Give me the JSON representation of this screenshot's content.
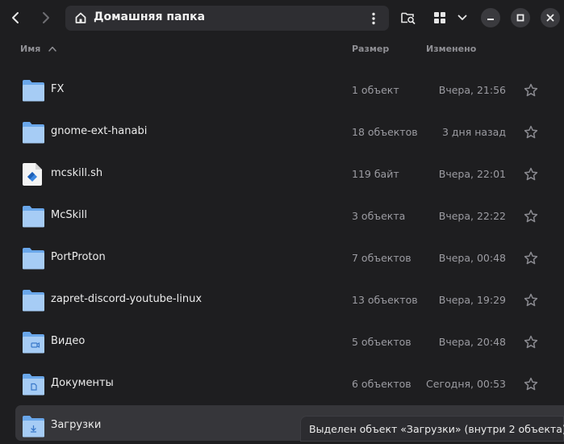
{
  "header": {
    "path_title": "Домашняя папка",
    "icons": [
      "chevron-left-icon",
      "chevron-right-icon",
      "home-icon",
      "kebab-menu-icon",
      "folder-search-icon",
      "grid-view-icon",
      "chevron-down-icon",
      "minimize-icon",
      "maximize-icon",
      "close-icon"
    ]
  },
  "columns": {
    "name": "Имя",
    "size": "Размер",
    "modified": "Изменено",
    "sort": "ascending"
  },
  "files": [
    {
      "name": "FX",
      "size": "1 объект",
      "modified": "Вчера, 21:56",
      "icon": "folder-icon"
    },
    {
      "name": "gnome-ext-hanabi",
      "size": "18 объектов",
      "modified": "3 дня назад",
      "icon": "folder-icon"
    },
    {
      "name": "mcskill.sh",
      "size": "119 байт",
      "modified": "Вчера, 22:01",
      "icon": "script-file-icon"
    },
    {
      "name": "McSkill",
      "size": "3 объекта",
      "modified": "Вчера, 22:22",
      "icon": "folder-icon"
    },
    {
      "name": "PortProton",
      "size": "7 объектов",
      "modified": "Вчера, 00:48",
      "icon": "folder-icon"
    },
    {
      "name": "zapret-discord-youtube-linux",
      "size": "13 объектов",
      "modified": "Вчера, 19:29",
      "icon": "folder-icon"
    },
    {
      "name": "Видео",
      "size": "5 объектов",
      "modified": "Вчера, 20:48",
      "icon": "videos-folder-icon"
    },
    {
      "name": "Документы",
      "size": "6 объектов",
      "modified": "Сегодня, 00:53",
      "icon": "documents-folder-icon"
    },
    {
      "name": "Загрузки",
      "size": "",
      "modified": "",
      "icon": "downloads-folder-icon",
      "selected": true
    }
  ],
  "status": {
    "text": "Выделен объект «Загрузки»  (внутри 2 объекта)"
  },
  "colors": {
    "background": "#1e1e20",
    "pathbar": "#2e2e32",
    "folder_front": "#a6ccf5",
    "folder_back": "#6aa7ea",
    "selection": "#36363a"
  }
}
